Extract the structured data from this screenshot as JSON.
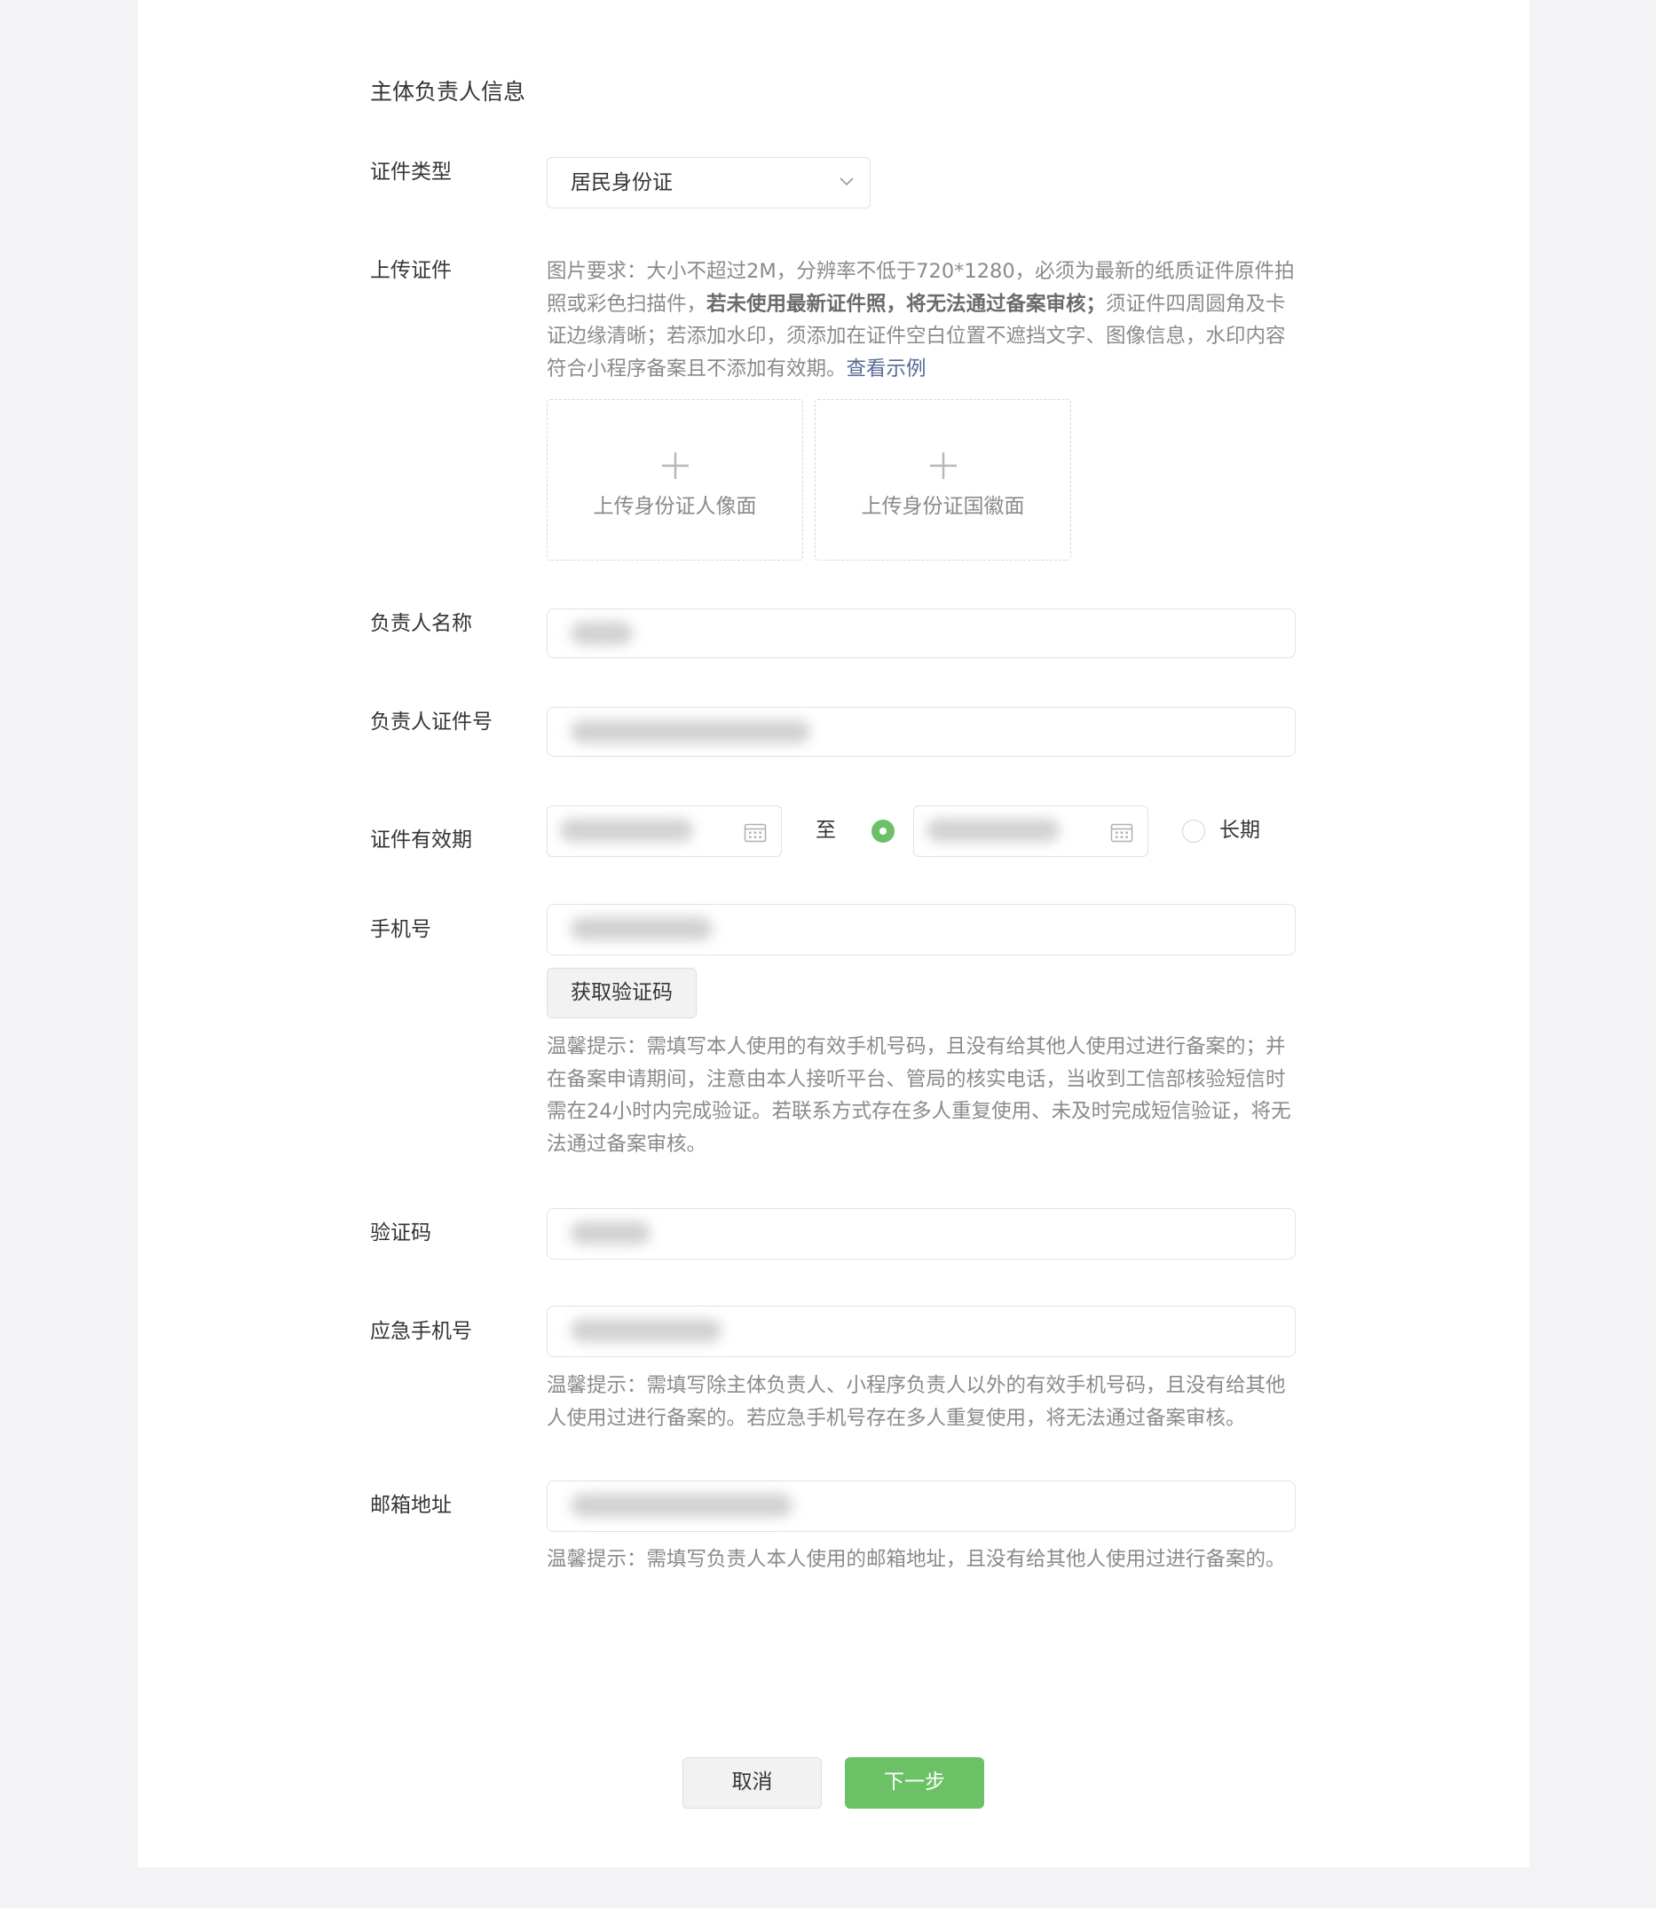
{
  "section_title": "主体负责人信息",
  "id_type": {
    "label": "证件类型",
    "value": "居民身份证"
  },
  "upload": {
    "label": "上传证件",
    "requirement_part1": "图片要求：大小不超过2M，分辨率不低于720*1280，必须为最新的纸质证件原件拍照或彩色扫描件，",
    "requirement_bold": "若未使用最新证件照，将无法通过备案审核；",
    "requirement_part2": "须证件四周圆角及卡证边缘清晰；若添加水印，须添加在证件空白位置不遮挡文字、图像信息，水印内容符合小程序备案且不添加有效期。",
    "example_link": "查看示例",
    "front_label": "上传身份证人像面",
    "back_label": "上传身份证国徽面"
  },
  "name": {
    "label": "负责人名称"
  },
  "id_number": {
    "label": "负责人证件号"
  },
  "validity": {
    "label": "证件有效期",
    "separator": "至",
    "long_term_label": "长期"
  },
  "phone": {
    "label": "手机号",
    "get_code_button": "获取验证码",
    "tip": "温馨提示：需填写本人使用的有效手机号码，且没有给其他人使用过进行备案的；并在备案申请期间，注意由本人接听平台、管局的核实电话，当收到工信部核验短信时需在24小时内完成验证。若联系方式存在多人重复使用、未及时完成短信验证，将无法通过备案审核。"
  },
  "verify_code": {
    "label": "验证码"
  },
  "emergency_phone": {
    "label": "应急手机号",
    "tip": "温馨提示：需填写除主体负责人、小程序负责人以外的有效手机号码，且没有给其他人使用过进行备案的。若应急手机号存在多人重复使用，将无法通过备案审核。"
  },
  "email": {
    "label": "邮箱地址",
    "tip": "温馨提示：需填写负责人本人使用的邮箱地址，且没有给其他人使用过进行备案的。"
  },
  "footer": {
    "cancel_label": "取消",
    "next_label": "下一步"
  },
  "colors": {
    "primary_green": "#6cc167",
    "link_blue": "#576b95",
    "page_background": "#f3f3f5"
  },
  "icons": {
    "select_arrow": "chevron-down-icon",
    "upload_add": "plus-icon",
    "date_picker": "calendar-icon"
  }
}
